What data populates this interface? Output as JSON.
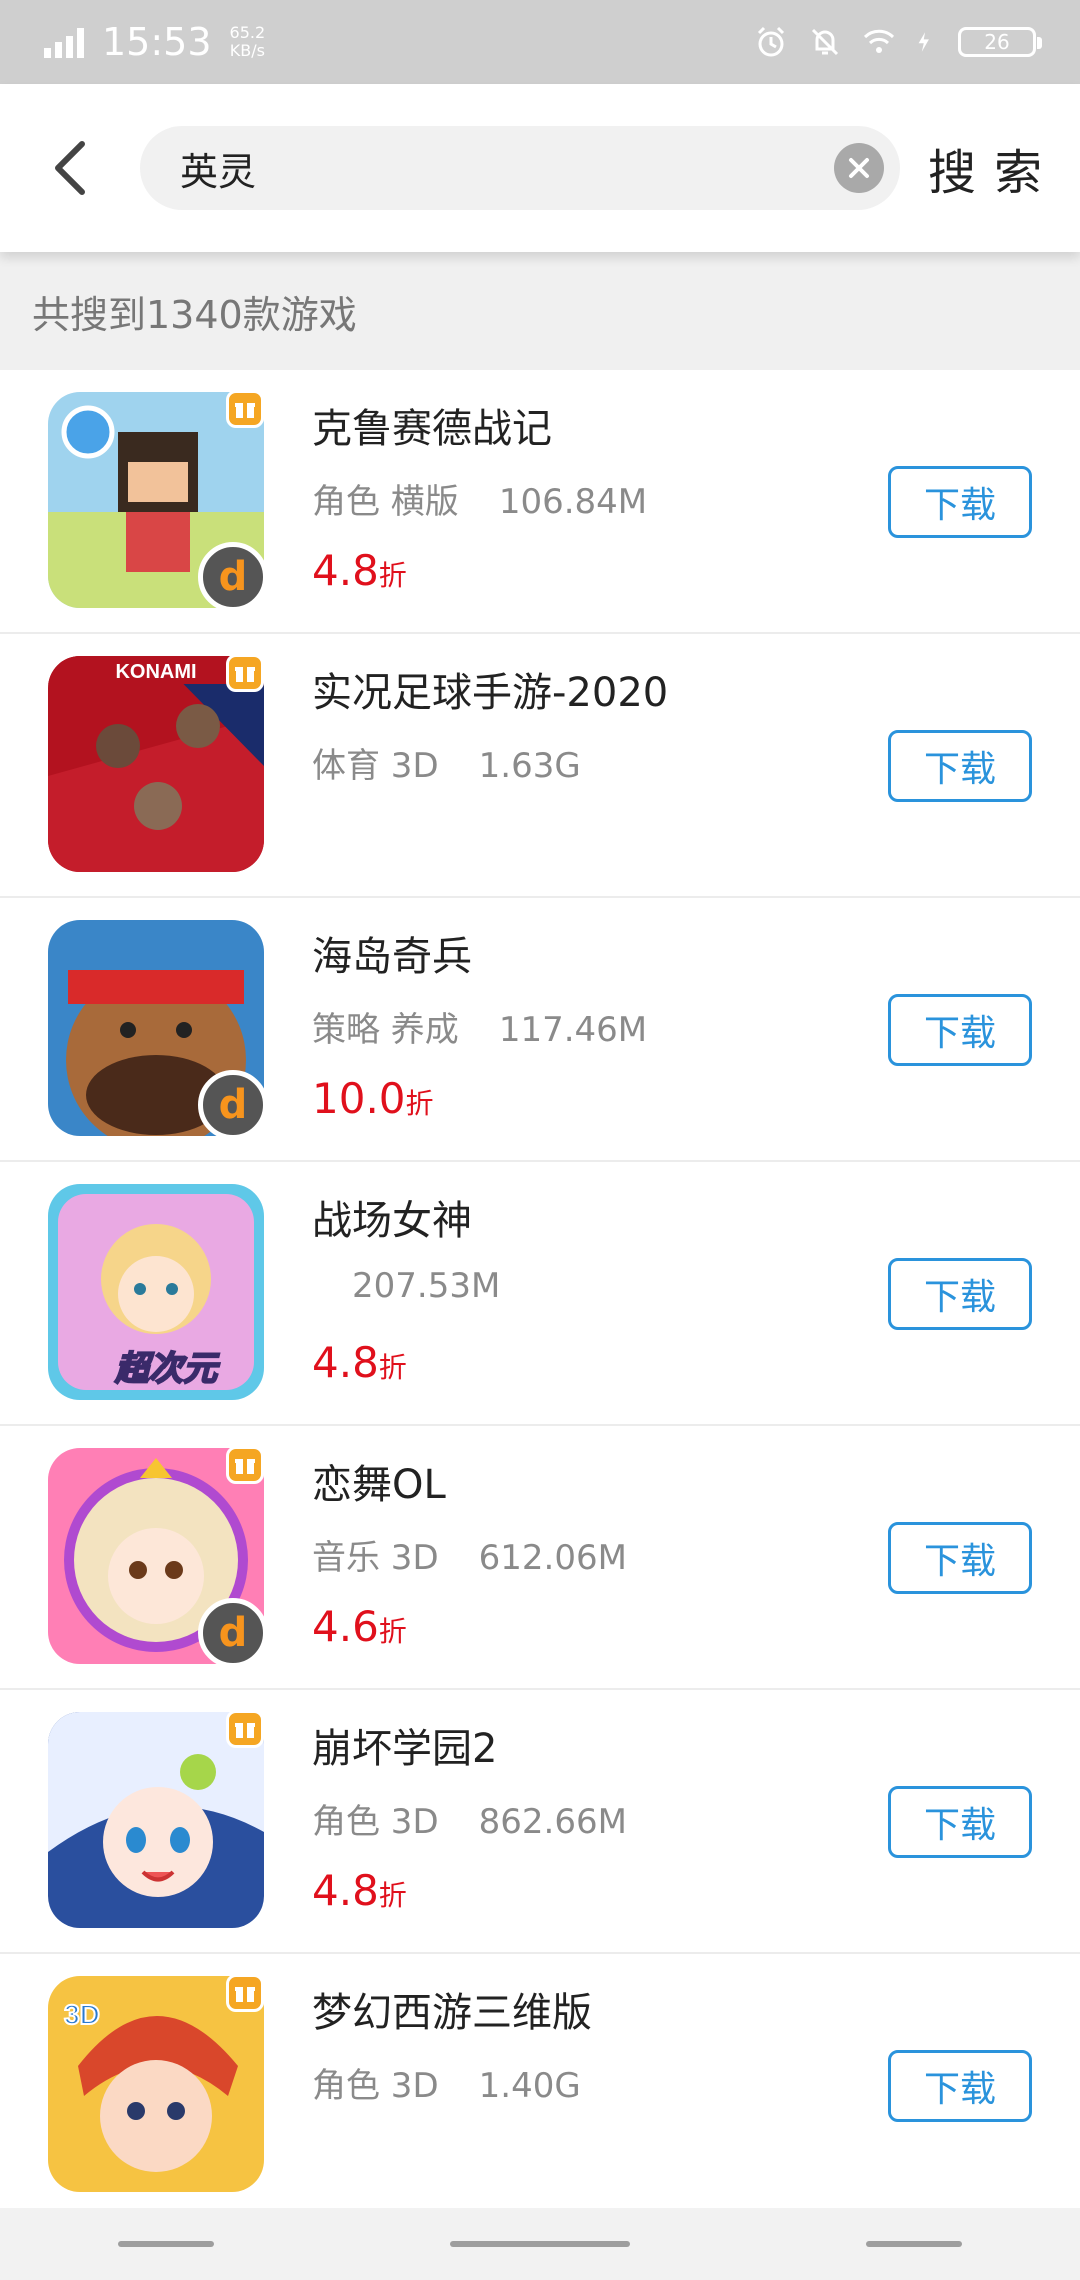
{
  "status_bar": {
    "time": "15:53",
    "net_speed_value": "65.2",
    "net_speed_unit": "KB/s",
    "battery": "26"
  },
  "header": {
    "query": "英灵",
    "search_label": "搜索"
  },
  "result_count": "共搜到1340款游戏",
  "games": [
    {
      "name": "克鲁赛德战记",
      "tags": "角色 横版",
      "size": "106.84M",
      "discount": "4.8",
      "discount_unit": "折",
      "download": "下载",
      "icon_colors": [
        "#7cc1e8",
        "#c9e07a"
      ]
    },
    {
      "name": "实况足球手游-2020",
      "tags": "体育 3D",
      "size": "1.63G",
      "discount": "",
      "discount_unit": "",
      "download": "下载",
      "icon_colors": [
        "#b3121f",
        "#1a2c6b"
      ]
    },
    {
      "name": "海岛奇兵",
      "tags": "策略 养成",
      "size": "117.46M",
      "discount": "10.0",
      "discount_unit": "折",
      "download": "下载",
      "icon_colors": [
        "#3a86c8",
        "#7a4a2a"
      ]
    },
    {
      "name": "战场女神",
      "tags": "",
      "size": "207.53M",
      "discount": "4.8",
      "discount_unit": "折",
      "download": "下载",
      "icon_colors": [
        "#8de3f0",
        "#e08bd6"
      ]
    },
    {
      "name": "恋舞OL",
      "tags": "音乐 3D",
      "size": "612.06M",
      "discount": "4.6",
      "discount_unit": "折",
      "download": "下载",
      "icon_colors": [
        "#ff7fb5",
        "#f3e3c0"
      ]
    },
    {
      "name": "崩坏学园2",
      "tags": "角色 3D",
      "size": "862.66M",
      "discount": "4.8",
      "discount_unit": "折",
      "download": "下载",
      "icon_colors": [
        "#dfe9ff",
        "#2a4f9e"
      ]
    },
    {
      "name": "梦幻西游三维版",
      "tags": "角色 3D",
      "size": "1.40G",
      "discount": "",
      "discount_unit": "",
      "download": "下载",
      "icon_colors": [
        "#f6c342",
        "#d9472b"
      ]
    }
  ]
}
